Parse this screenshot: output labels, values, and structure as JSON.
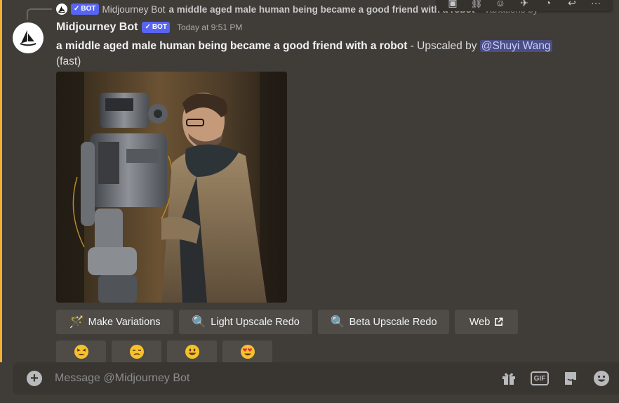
{
  "reply": {
    "bot_badge": "BOT",
    "author": "Midjourney Bot",
    "text": "a middle aged male human being became a good friend with a robot",
    "suffix": "- Variations by"
  },
  "message": {
    "author": "Midjourney Bot",
    "bot_badge": "BOT",
    "timestamp": "Today at 9:51 PM",
    "prompt": "a middle aged male human being became a good friend with a robot",
    "separator": " - Upscaled by ",
    "mention": "@Shuyi Wang",
    "mode": "(fast)"
  },
  "buttons": {
    "make_variations": "Make Variations",
    "light_upscale_redo": "Light Upscale Redo",
    "beta_upscale_redo": "Beta Upscale Redo",
    "web": "Web"
  },
  "reactions": [
    "tired-face",
    "unamused-face",
    "grinning-face",
    "heart-eyes-face"
  ],
  "composer": {
    "placeholder": "Message @Midjourney Bot"
  },
  "colors": {
    "background": "#403c37",
    "accent_left": "#f0b232",
    "bot_badge": "#5865f2",
    "mention_bg": "#4b4e85",
    "button_bg": "#4f4c47"
  }
}
